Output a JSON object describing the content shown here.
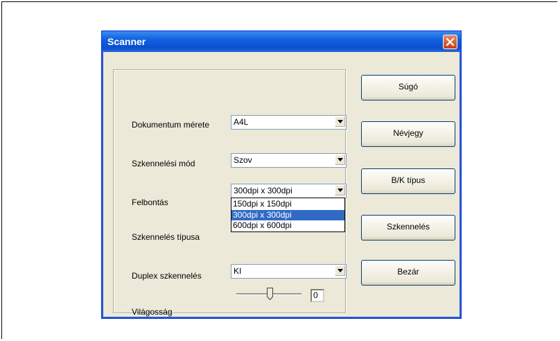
{
  "window": {
    "title": "Scanner"
  },
  "form": {
    "doc_size_label": "Dokumentum mérete",
    "doc_size_value": "A4L",
    "scan_mode_label": "Szkennelési mód",
    "scan_mode_value": "Szov",
    "resolution_label": "Felbontás",
    "resolution_value": "300dpi x 300dpi",
    "resolution_options": [
      "150dpi x 150dpi",
      "300dpi x 300dpi",
      "600dpi x 600dpi"
    ],
    "scan_type_label": "Szkennelés típusa",
    "duplex_label": "Duplex szkennelés",
    "duplex_value": "KI",
    "brightness_label": "Világosság",
    "brightness_value": "0"
  },
  "buttons": {
    "help": "Súgó",
    "about": "Névjegy",
    "bw_type": "B/K típus",
    "scan": "Szkennelés",
    "close": "Bezár"
  },
  "icons": [
    "close-icon",
    "dropdown-arrow-icon",
    "slider-thumb-icon"
  ]
}
